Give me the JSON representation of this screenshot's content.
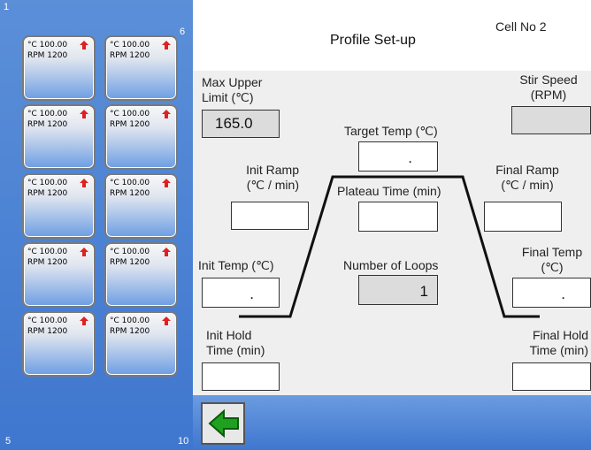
{
  "left_panel": {
    "corner_top_left": "1",
    "corner_top_right": "6",
    "corner_bottom_left": "5",
    "corner_bottom_right": "10",
    "cells": [
      {
        "temp": "°C 100.00",
        "rpm": "RPM 1200"
      },
      {
        "temp": "°C 100.00",
        "rpm": "RPM 1200"
      },
      {
        "temp": "°C 100.00",
        "rpm": "RPM 1200"
      },
      {
        "temp": "°C 100.00",
        "rpm": "RPM 1200"
      },
      {
        "temp": "°C 100.00",
        "rpm": "RPM 1200"
      },
      {
        "temp": "°C 100.00",
        "rpm": "RPM 1200"
      },
      {
        "temp": "°C 100.00",
        "rpm": "RPM 1200"
      },
      {
        "temp": "°C 100.00",
        "rpm": "RPM 1200"
      },
      {
        "temp": "°C 100.00",
        "rpm": "RPM 1200"
      },
      {
        "temp": "°C 100.00",
        "rpm": "RPM 1200"
      }
    ]
  },
  "header": {
    "title": "Profile Set-up",
    "cell_no": "Cell No 2"
  },
  "form": {
    "max_upper_limit_label_1": "Max Upper",
    "max_upper_limit_label_2": "Limit (℃)",
    "max_upper_limit_value": "165.0",
    "stir_speed_label_1": "Stir Speed",
    "stir_speed_label_2": "(RPM)",
    "stir_speed_value": "",
    "target_temp_label": "Target Temp (℃)",
    "target_temp_value": ".",
    "init_ramp_label_1": "Init Ramp",
    "init_ramp_label_2": "(℃ / min)",
    "init_ramp_value": "",
    "plateau_time_label": "Plateau Time  (min)",
    "plateau_time_value": "",
    "final_ramp_label_1": "Final  Ramp",
    "final_ramp_label_2": "(℃ / min)",
    "final_ramp_value": "",
    "init_temp_label": "Init Temp (℃)",
    "init_temp_value": ".",
    "number_of_loops_label": "Number of Loops",
    "number_of_loops_value": "1",
    "final_temp_label_1": "Final Temp",
    "final_temp_label_2": "(℃)",
    "final_temp_value": ".",
    "init_hold_label_1": "Init Hold",
    "init_hold_label_2": "Time (min)",
    "init_hold_value": "",
    "final_hold_label_1": "Final Hold",
    "final_hold_label_2": "Time (min)",
    "final_hold_value": ""
  },
  "colors": {
    "panel_blue": "#4a82d6",
    "arrow_red": "#e02020",
    "back_arrow_green": "#1fa01f"
  },
  "icons": {
    "cell_status": "red-up-arrow-icon",
    "back": "green-left-arrow-icon"
  }
}
